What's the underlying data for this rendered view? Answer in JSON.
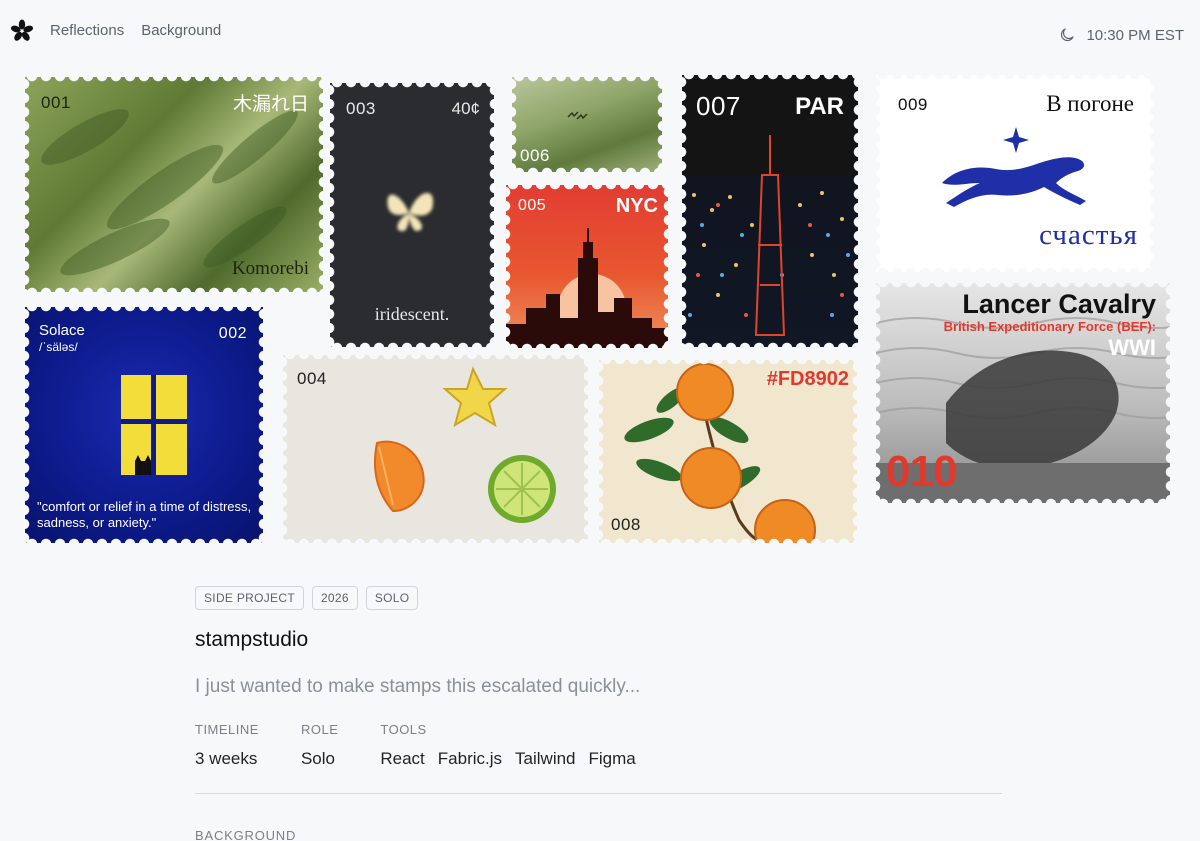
{
  "nav": {
    "items": [
      "Reflections",
      "Background"
    ]
  },
  "clock": {
    "time": "10:30 PM EST"
  },
  "stamps": {
    "s001": {
      "number": "001",
      "jp": "木漏れ日",
      "caption": "Komorebi"
    },
    "s003": {
      "number": "003",
      "price": "40¢",
      "caption": "iridescent."
    },
    "s006": {
      "number": "006"
    },
    "s005": {
      "number": "005",
      "city": "NYC"
    },
    "s007": {
      "number": "007",
      "city": "PAR"
    },
    "s009": {
      "number": "009",
      "top": "В погоне",
      "bottom": "счастья"
    },
    "s002": {
      "number": "002",
      "word": "Solace",
      "phonetic": "/ˈsäləs/",
      "definition": "\"comfort or relief in a time of distress, sadness, or anxiety.\""
    },
    "s004": {
      "number": "004"
    },
    "s008": {
      "number": "008",
      "hex": "#FD8902"
    },
    "s010": {
      "number": "010",
      "title": "Lancer Cavalry",
      "sub": "British Expeditionary Force (BEF):",
      "war": "WWI"
    }
  },
  "project": {
    "tags": [
      "SIDE PROJECT",
      "2026",
      "SOLO"
    ],
    "title": "stampstudio",
    "subtitle": "I just wanted to make stamps this escalated quickly...",
    "timeline_label": "TIMELINE",
    "timeline": "3 weeks",
    "role_label": "ROLE",
    "role": "Solo",
    "tools_label": "TOOLS",
    "tools": [
      "React",
      "Fabric.js",
      "Tailwind",
      "Figma"
    ],
    "background_label": "BACKGROUND"
  },
  "colors": {
    "accent_red": "#e03a2e",
    "navy": "#0f1c8f",
    "bg": "#f7f8fa"
  }
}
